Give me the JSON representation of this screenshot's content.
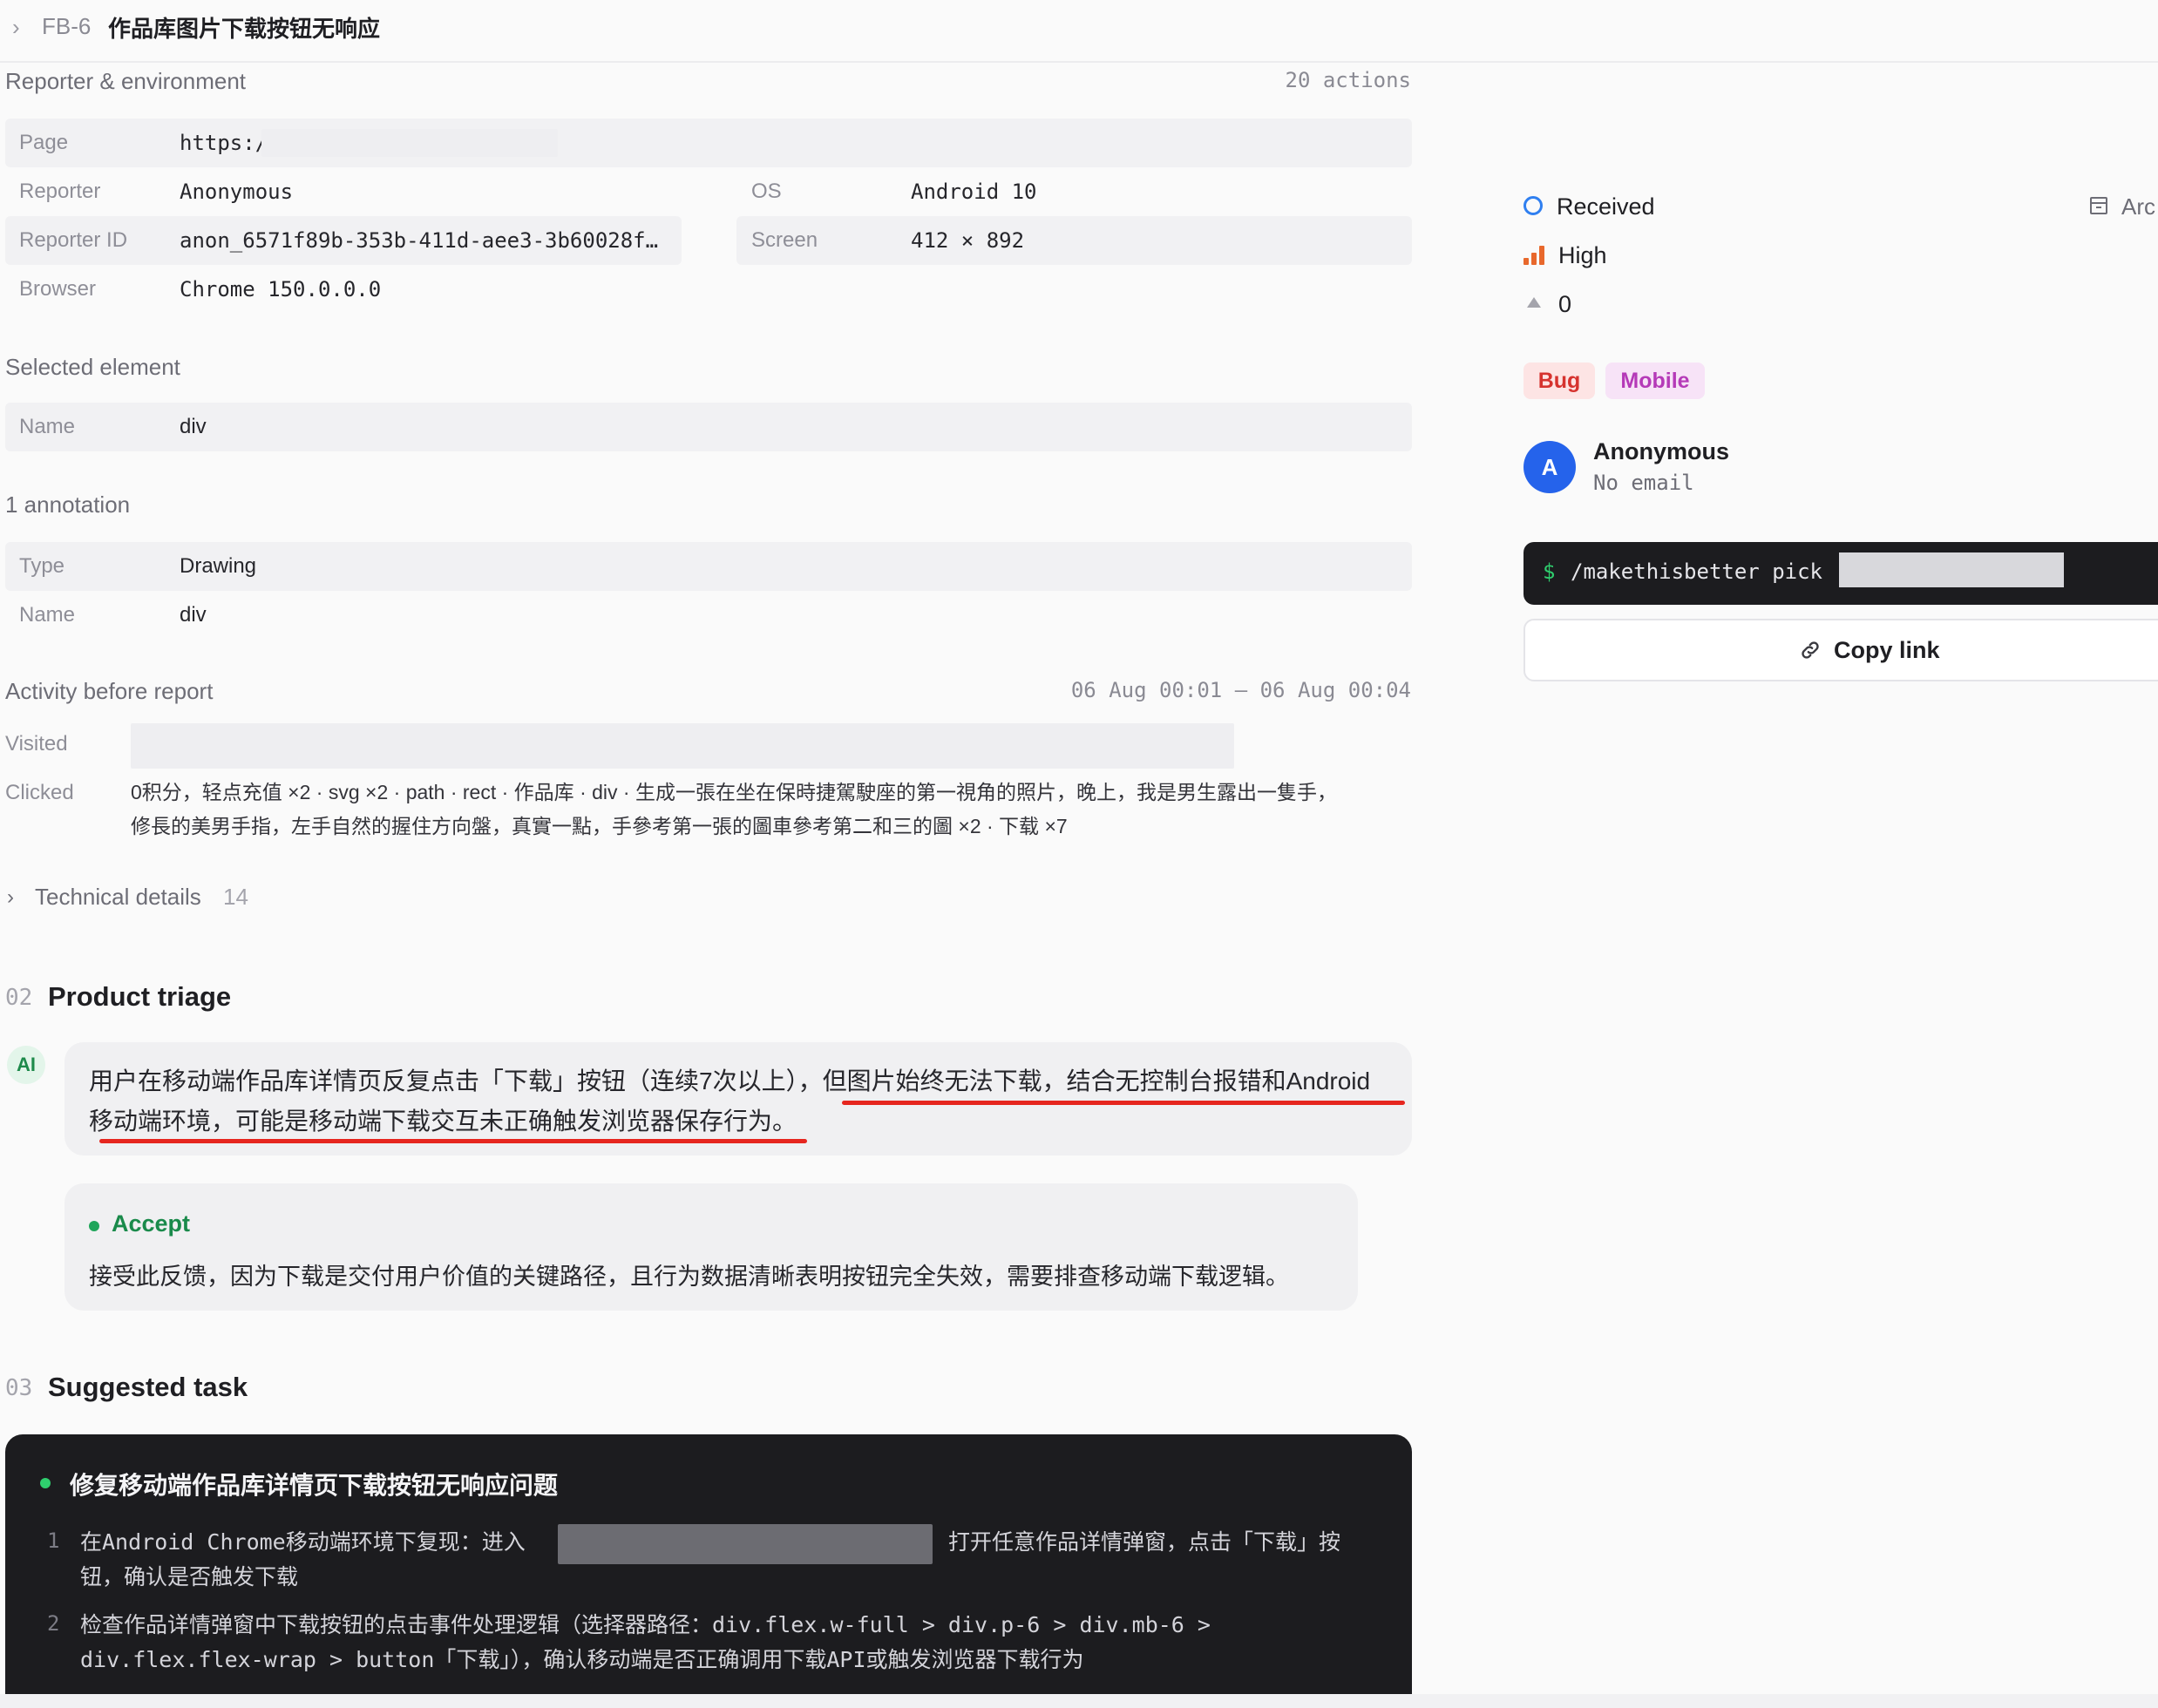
{
  "header": {
    "issue_id": "FB-6",
    "title": "作品库图片下载按钮无响应"
  },
  "reporter_section": {
    "heading": "Reporter & environment",
    "actions": "20 actions",
    "fields": {
      "page_label": "Page",
      "page_value": "https:/",
      "reporter_label": "Reporter",
      "reporter_value": "Anonymous",
      "reporter_id_label": "Reporter ID",
      "reporter_id_value": "anon_6571f89b-353b-411d-aee3-3b60028f…",
      "browser_label": "Browser",
      "browser_value": "Chrome 150.0.0.0",
      "os_label": "OS",
      "os_value": "Android 10",
      "screen_label": "Screen",
      "screen_value": "412 × 892"
    }
  },
  "selected_element": {
    "heading": "Selected element",
    "name_label": "Name",
    "name_value": "div"
  },
  "annotation": {
    "heading": "1 annotation",
    "type_label": "Type",
    "type_value": "Drawing",
    "name_label": "Name",
    "name_value": "div"
  },
  "activity": {
    "heading": "Activity before report",
    "range": "06 Aug 00:01 – 06 Aug 00:04",
    "visited_label": "Visited",
    "clicked_label": "Clicked",
    "clicked_line1": "0积分，轻点充值 ×2 · svg ×2 · path · rect · 作品库 · div · 生成一張在坐在保時捷駕駛座的第一視角的照片，晚上，我是男生露出一隻手，",
    "clicked_line2": "修長的美男手指，左手自然的握住方向盤，真實一點，手參考第一張的圖車參考第二和三的圖 ×2 · 下载 ×7"
  },
  "technical": {
    "label": "Technical details",
    "count": "14"
  },
  "triage": {
    "num": "02",
    "title": "Product triage",
    "ai_badge": "AI",
    "ai_line1": "用户在移动端作品库详情页反复点击「下载」按钮（连续7次以上），但图片始终无法下载，结合无控制台报错和Android",
    "ai_line2": "移动端环境，可能是移动端下载交互未正确触发浏览器保存行为。",
    "decision": "Accept",
    "decision_text": "接受此反馈，因为下载是交付用户价值的关键路径，且行为数据清晰表明按钮完全失效，需要排查移动端下载逻辑。"
  },
  "task": {
    "num": "03",
    "title": "Suggested task",
    "card_title": "修复移动端作品库详情页下载按钮无响应问题",
    "steps": [
      {
        "num": "1",
        "line1a": "在Android Chrome移动端环境下复现：进入",
        "line1b": "打开任意作品详情弹窗，点击「下载」按",
        "line2": "钮，确认是否触发下载"
      },
      {
        "num": "2",
        "line1": "检查作品详情弹窗中下载按钮的点击事件处理逻辑（选择器路径：div.flex.w-full > div.p-6 > div.mb-6 >",
        "line2": "div.flex.flex-wrap > button「下载」），确认移动端是否正确调用下载API或触发浏览器下载行为"
      }
    ]
  },
  "sidebar": {
    "status": "Received",
    "priority": "High",
    "votes": "0",
    "archive": "Arc",
    "tags": [
      "Bug",
      "Mobile"
    ],
    "user_initial": "A",
    "user_name": "Anonymous",
    "user_email": "No email",
    "command_prompt": "$",
    "command": "/makethisbetter pick",
    "copy_label": "Copy link"
  },
  "colors": {
    "accent_blue": "#2f7ff0",
    "priority_orange": "#e8682c",
    "accept_green": "#1a8a4b",
    "highlight_red": "#e6261f"
  }
}
